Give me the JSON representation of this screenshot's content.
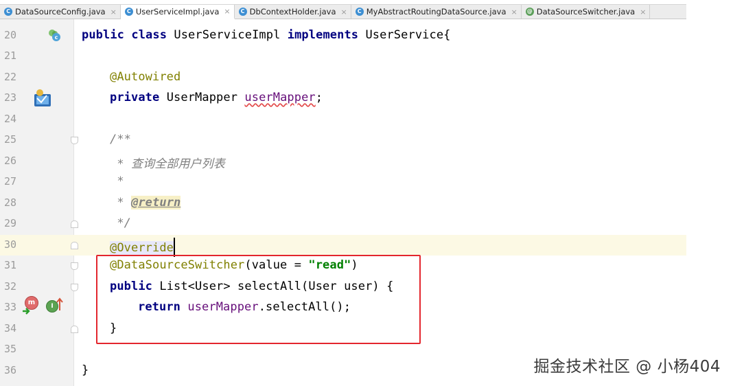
{
  "tabs": [
    {
      "label": "DataSourceConfig.java",
      "icon": "class-icon",
      "letter": "C",
      "active": false
    },
    {
      "label": "UserServiceImpl.java",
      "icon": "class-icon",
      "letter": "C",
      "active": true
    },
    {
      "label": "DbContextHolder.java",
      "icon": "class-icon",
      "letter": "C",
      "active": false
    },
    {
      "label": "MyAbstractRoutingDataSource.java",
      "icon": "class-icon",
      "letter": "C",
      "active": false
    },
    {
      "label": "DataSourceSwitcher.java",
      "icon": "annotation-icon",
      "letter": "@",
      "active": false
    }
  ],
  "close_glyph": "×",
  "lines": {
    "l20": "20",
    "l21": "21",
    "l22": "22",
    "l23": "23",
    "l24": "24",
    "l25": "25",
    "l26": "26",
    "l27": "27",
    "l28": "28",
    "l29": "29",
    "l30": "30",
    "l31": "31",
    "l32": "32",
    "l33": "33",
    "l34": "34",
    "l35": "35",
    "l36": "36"
  },
  "code": {
    "public": "public",
    "class": "class",
    "implements": "implements",
    "class_name": "UserServiceImpl",
    "interface_name": "UserService{",
    "autowired": "@Autowired",
    "private": "private",
    "mapper_type": "UserMapper",
    "mapper_field": "userMapper",
    "semicolon": ";",
    "doc_open": "/**",
    "doc_desc": " * 查询全部用户列表",
    "doc_star": " *",
    "doc_star_prefix": " * ",
    "doc_return": "@return",
    "doc_close": " */",
    "override": "@Override",
    "switcher_ann": "@DataSourceSwitcher",
    "switcher_args_open": "(value = ",
    "switcher_value": "\"read\"",
    "switcher_args_close": ")",
    "method_sig": "List<User> selectAll(User user) {",
    "return": "return",
    "return_call": ".selectAll();",
    "close_brace": "}",
    "class_close": "}"
  },
  "gutter_icons": {
    "m_letter": "m",
    "i_letter": "I"
  },
  "watermark": "掘金技术社区 @ 小杨404",
  "colors": {
    "keyword": "#000080",
    "annotation": "#808000",
    "string": "#008000",
    "field": "#660e7a",
    "comment": "#808080",
    "highlight_box": "#e3262d",
    "current_line": "#fcf9e4"
  }
}
